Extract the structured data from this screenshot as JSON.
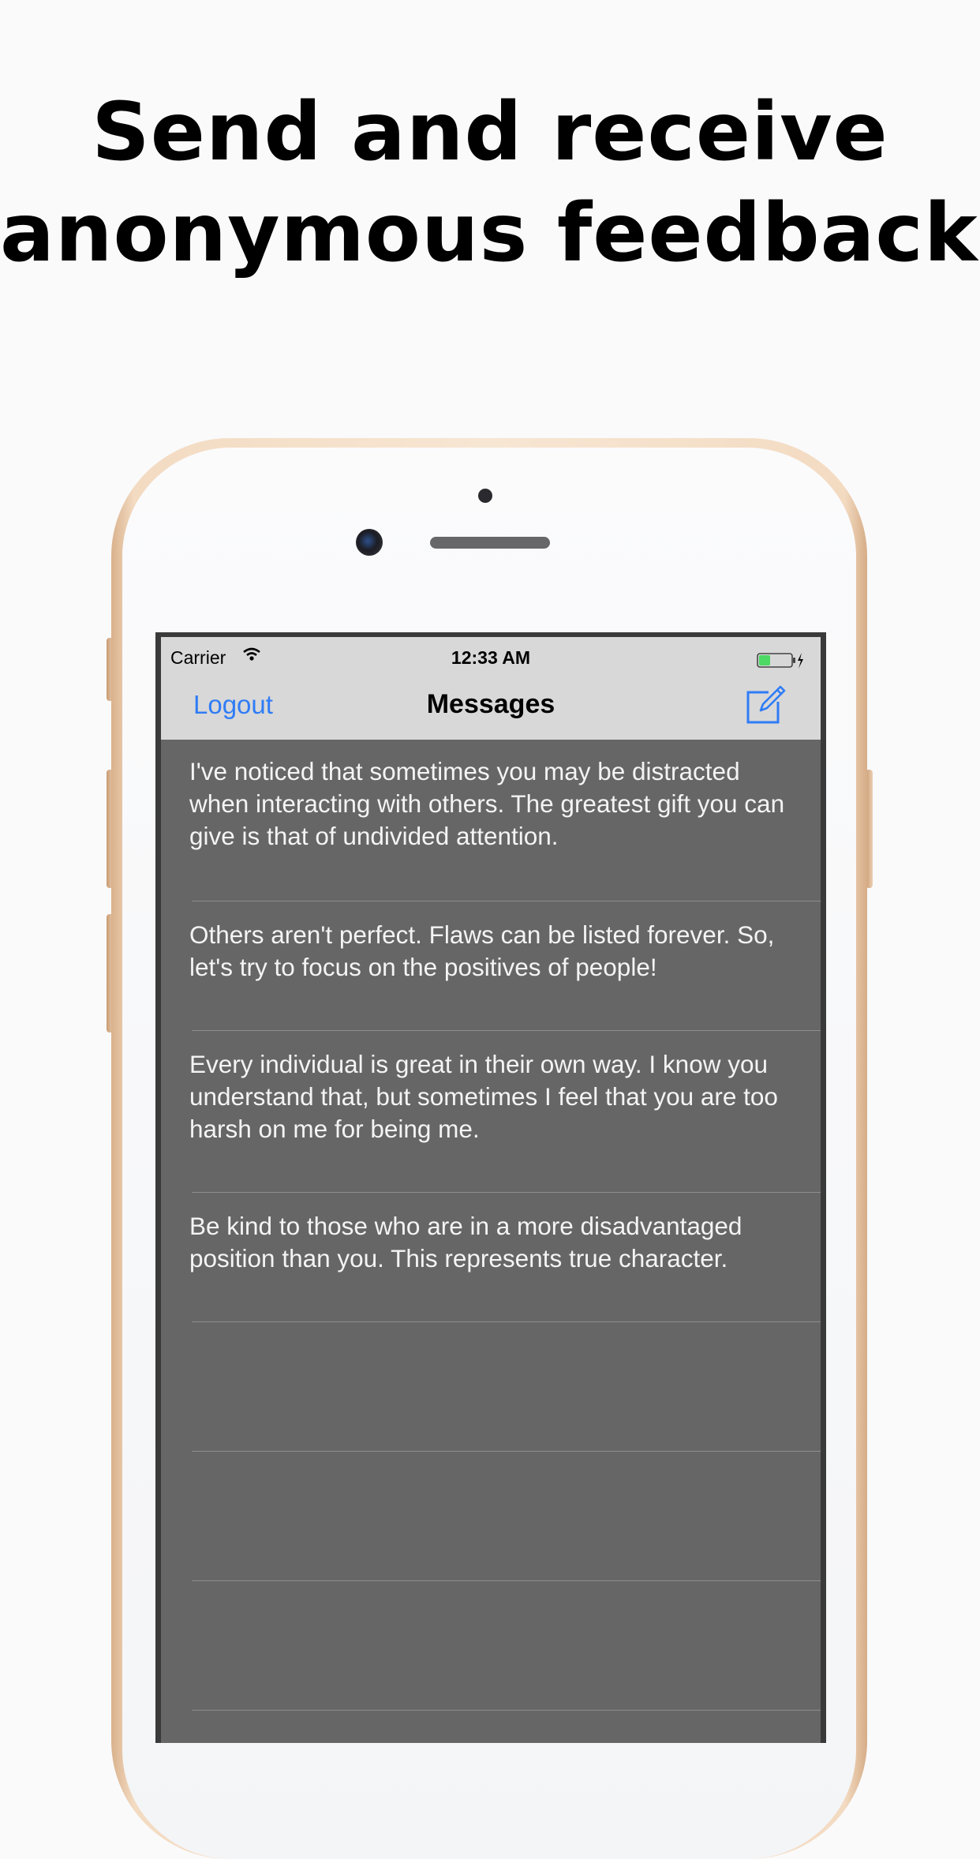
{
  "headline": {
    "line1": "Send and receive",
    "line2": "anonymous feedback."
  },
  "status_bar": {
    "carrier": "Carrier",
    "time": "12:33 AM",
    "battery_color": "#4cd964"
  },
  "nav_bar": {
    "left_button": "Logout",
    "title": "Messages",
    "right_icon": "compose-icon",
    "accent_color": "#2f7cf6"
  },
  "messages": [
    {
      "text": "I've noticed that sometimes you may be distracted when interacting with others. The greatest gift you can give is that of undivided attention."
    },
    {
      "text": "Others aren't perfect. Flaws can be listed forever. So, let's try to focus on the positives of people!"
    },
    {
      "text": "Every individual is great in their own way. I know you understand that, but sometimes I feel that you are too harsh on me for being me."
    },
    {
      "text": "Be kind to those who are in a more disadvantaged position than you. This represents true character."
    },
    {
      "text": ""
    },
    {
      "text": ""
    },
    {
      "text": ""
    }
  ]
}
